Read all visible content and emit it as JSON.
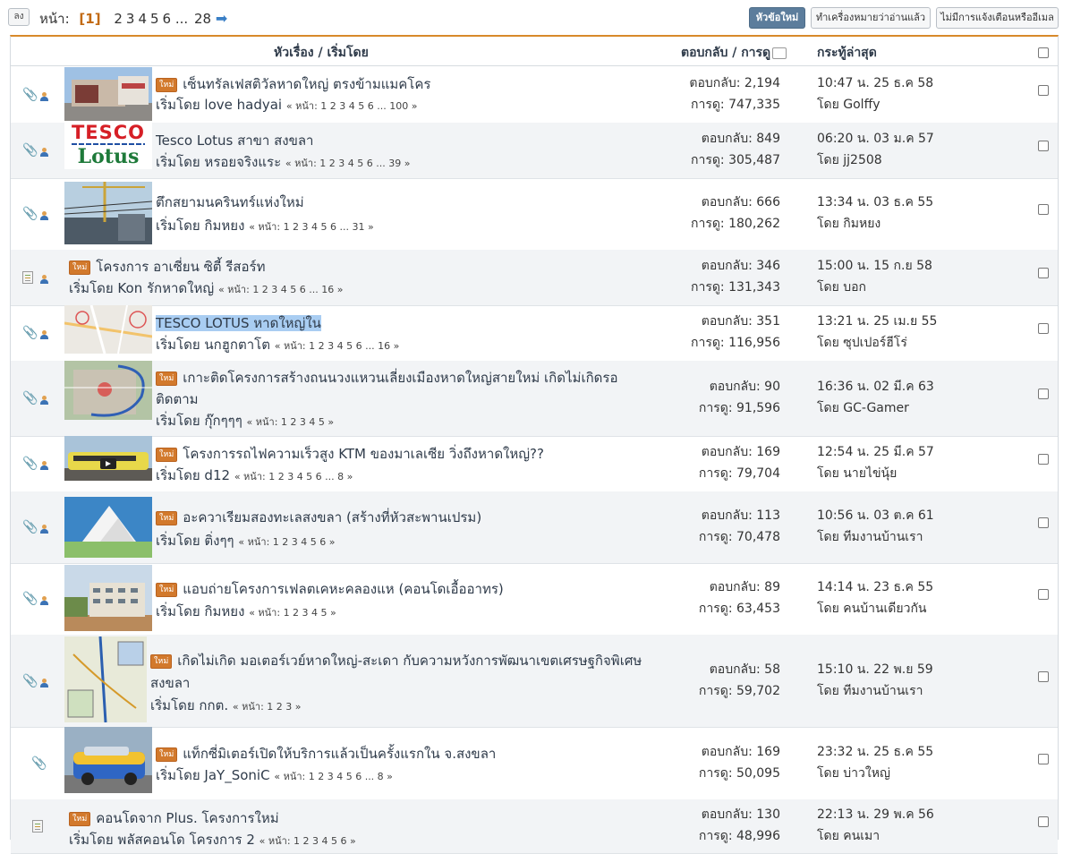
{
  "topbar": {
    "down_label": "ลง",
    "pages_label": "หน้า:",
    "current_page": "[1]",
    "pages": [
      "2",
      "3",
      "4",
      "5",
      "6"
    ],
    "ellipsis": "...",
    "last_page": "28",
    "new_topic": "หัวข้อใหม่",
    "mark_read": "ทำเครื่องหมายว่าอ่านแล้ว",
    "no_notify": "ไม่มีการแจ้งเตือนหรืออีเมล"
  },
  "header": {
    "subject": "หัวเรื่อง / เริ่มโดย",
    "replies": "ตอบกลับ / การดู",
    "last_post": "กระทู้ล่าสุด"
  },
  "new_badge": "ใหม่",
  "topics": [
    {
      "title": "เซ็นทรัลเฟสติวัลหาดใหญ่ ตรงข้ามแมคโคร",
      "title2": "",
      "new": true,
      "starter": "เริ่มโดย love hadyai",
      "pages": "« หน้า: 1 2 3 4 5 6 ... 100 »",
      "replies": "ตอบกลับ: 2,194",
      "views": "การดู: 747,335",
      "last_time": "10:47 น. 25 ธ.ค 58",
      "last_by": "โดย Golffy",
      "icon": "clip",
      "thumb": "mall"
    },
    {
      "title": "Tesco Lotus สาขา สงขลา",
      "title2": "",
      "new": false,
      "starter": "เริ่มโดย หรอยจริงแระ",
      "pages": "« หน้า: 1 2 3 4 5 6 ... 39 »",
      "replies": "ตอบกลับ: 849",
      "views": "การดู: 305,487",
      "last_time": "06:20 น. 03 ม.ค 57",
      "last_by": "โดย jj2508",
      "icon": "clip",
      "thumb": "tesco",
      "logo_top": "TESCO",
      "logo_bottom": "Lotus"
    },
    {
      "title": "ตึกสยามนครินทร์แห่งใหม่",
      "title2": "",
      "new": false,
      "starter": "เริ่มโดย กิมหยง",
      "pages": "« หน้า: 1 2 3 4 5 6 ... 31 »",
      "replies": "ตอบกลับ: 666",
      "views": "การดู: 180,262",
      "last_time": "13:34 น. 03 ธ.ค 55",
      "last_by": "โดย กิมหยง",
      "icon": "clip",
      "thumb": "crane"
    },
    {
      "title": "โครงการ อาเซี่ยน ซิตี้ รีสอร์ท",
      "title2": "",
      "new": true,
      "starter": "เริ่มโดย Kon รักหาดใหญ่",
      "pages": "« หน้า: 1 2 3 4 5 6 ... 16 »",
      "replies": "ตอบกลับ: 346",
      "views": "การดู: 131,343",
      "last_time": "15:00 น. 15 ก.ย 58",
      "last_by": "โดย บอก",
      "icon": "doc",
      "thumb": ""
    },
    {
      "title": "TESCO LOTUS หาดใหญ่ใน",
      "title2": "",
      "new": false,
      "highlight": true,
      "starter": "เริ่มโดย นกฮูกตาโต",
      "pages": "« หน้า: 1 2 3 4 5 6 ... 16 »",
      "replies": "ตอบกลับ: 351",
      "views": "การดู: 116,956",
      "last_time": "13:21 น. 25 เม.ย 55",
      "last_by": "โดย ซุปเปอร์ฮีโร่",
      "icon": "clip",
      "thumb": "map"
    },
    {
      "title": "เกาะติดโครงการสร้างถนนวงแหวนเลี่ยงเมืองหาดใหญ่สายใหม่ เกิดไม่เกิดรอ",
      "title2": "ติดตาม",
      "new": true,
      "starter": "เริ่มโดย กุ๊กๆๆๆ",
      "pages": "« หน้า: 1 2 3 4 5 »",
      "replies": "ตอบกลับ: 90",
      "views": "การดู: 91,596",
      "last_time": "16:36 น. 02 มี.ค 63",
      "last_by": "โดย GC-Gamer",
      "icon": "clip",
      "thumb": "ringroad"
    },
    {
      "title": "โครงการรถไฟความเร็วสูง KTM ของมาเลเซีย วิ่งถึงหาดใหญ่??",
      "title2": "",
      "new": true,
      "starter": "เริ่มโดย d12",
      "pages": "« หน้า: 1 2 3 4 5 6 ... 8 »",
      "replies": "ตอบกลับ: 169",
      "views": "การดู: 79,704",
      "last_time": "12:54 น. 25 มี.ค 57",
      "last_by": "โดย นายไข่นุ้ย",
      "icon": "clip",
      "thumb": "train"
    },
    {
      "title": "อะควาเรียมสองทะเลสงขลา (สร้างที่หัวสะพานเปรม)",
      "title2": "",
      "new": true,
      "starter": "เริ่มโดย ติ่งๆๆ",
      "pages": "« หน้า: 1 2 3 4 5 6 »",
      "replies": "ตอบกลับ: 113",
      "views": "การดู: 70,478",
      "last_time": "10:56 น. 03 ต.ค 61",
      "last_by": "โดย ทีมงานบ้านเรา",
      "icon": "clip",
      "thumb": "aquarium"
    },
    {
      "title": "แอบถ่ายโครงการเฟลตเคหะคลองแห (คอนโดเอื้ออาทร)",
      "title2": "",
      "new": true,
      "starter": "เริ่มโดย กิมหยง",
      "pages": "« หน้า: 1 2 3 4 5 »",
      "replies": "ตอบกลับ: 89",
      "views": "การดู: 63,453",
      "last_time": "14:14 น. 23 ธ.ค 55",
      "last_by": "โดย คนบ้านเดียวกัน",
      "icon": "clip",
      "thumb": "flats"
    },
    {
      "title": "เกิดไม่เกิด มอเตอร์เวย์หาดใหญ่-สะเดา กับความหวังการพัฒนาเขตเศรษฐกิจพิเศษ",
      "title2": "สงขลา",
      "new": true,
      "starter": "เริ่มโดย กกต.",
      "pages": "« หน้า: 1 2 3 »",
      "replies": "ตอบกลับ: 58",
      "views": "การดู: 59,702",
      "last_time": "15:10 น. 22 พ.ย 59",
      "last_by": "โดย ทีมงานบ้านเรา",
      "icon": "clip",
      "thumb": "motorway"
    },
    {
      "title": "แท็กซี่มิเตอร์เปิดให้บริการแล้วเป็นครั้งแรกใน จ.สงขลา",
      "title2": "",
      "new": true,
      "starter": "เริ่มโดย JaY_SoniC",
      "pages": "« หน้า: 1 2 3 4 5 6 ... 8 »",
      "replies": "ตอบกลับ: 169",
      "views": "การดู: 50,095",
      "last_time": "23:32 น. 25 ธ.ค 55",
      "last_by": "โดย บ่าวใหญ่",
      "icon": "clip-only",
      "thumb": "taxi"
    },
    {
      "title": "คอนโดจาก Plus. โครงการใหม่",
      "title2": "",
      "new": true,
      "starter": "เริ่มโดย พลัสคอนโด โครงการ 2",
      "pages": "« หน้า: 1 2 3 4 5 6 »",
      "replies": "ตอบกลับ: 130",
      "views": "การดู: 48,996",
      "last_time": "22:13 น. 29 พ.ค 56",
      "last_by": "โดย คนเมา",
      "icon": "doc-only",
      "thumb": ""
    }
  ]
}
